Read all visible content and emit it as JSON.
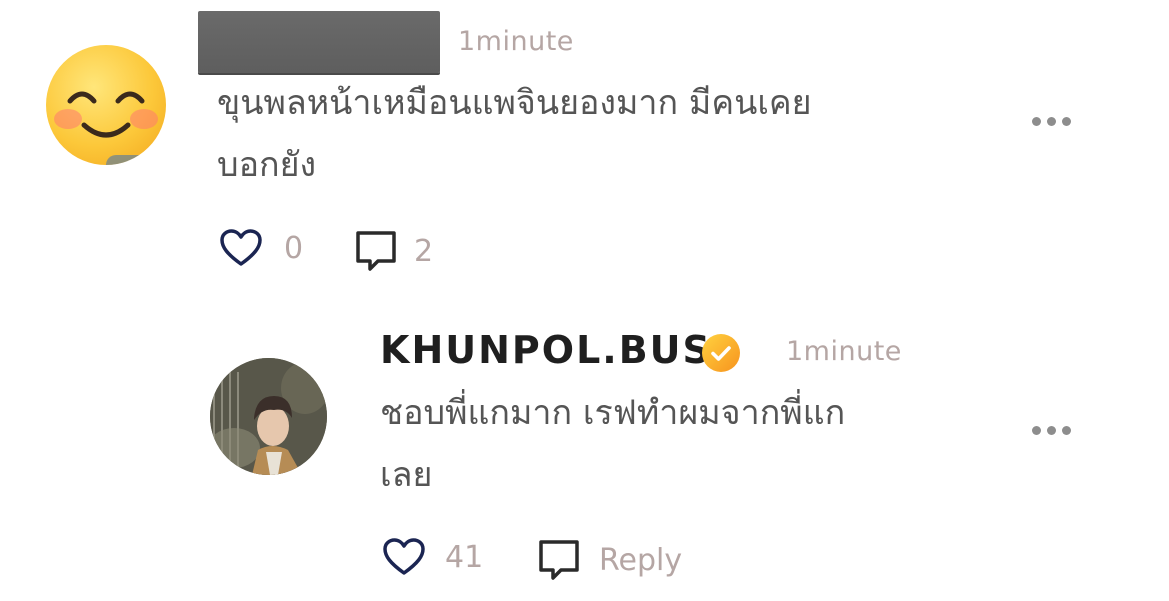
{
  "comments": [
    {
      "author": "",
      "time": "1minute",
      "text_line1": "ขุนพลหน้าเหมือนแพจินยองมาก มีคนเคย",
      "text_line2": "บอกยัง",
      "likes": "0",
      "replies": "2"
    },
    {
      "author": "KHUNPOL.BUS",
      "verified": true,
      "time": "1minute",
      "text_line1": "ชอบพี่แกมาก เรฟทำผมจากพี่แก",
      "text_line2": "เลย",
      "likes": "41",
      "reply_label": "Reply"
    }
  ],
  "colors": {
    "icon_navy": "#1b2552",
    "muted_text": "#b5a6a4",
    "body_text": "#555555",
    "verified_orange": "#f7931e",
    "verified_yellow": "#ffd23f"
  },
  "icons": {
    "like": "heart-outline-icon",
    "comment": "speech-bubble-icon",
    "more": "more-horizontal-icon",
    "verified": "verified-check-icon"
  }
}
